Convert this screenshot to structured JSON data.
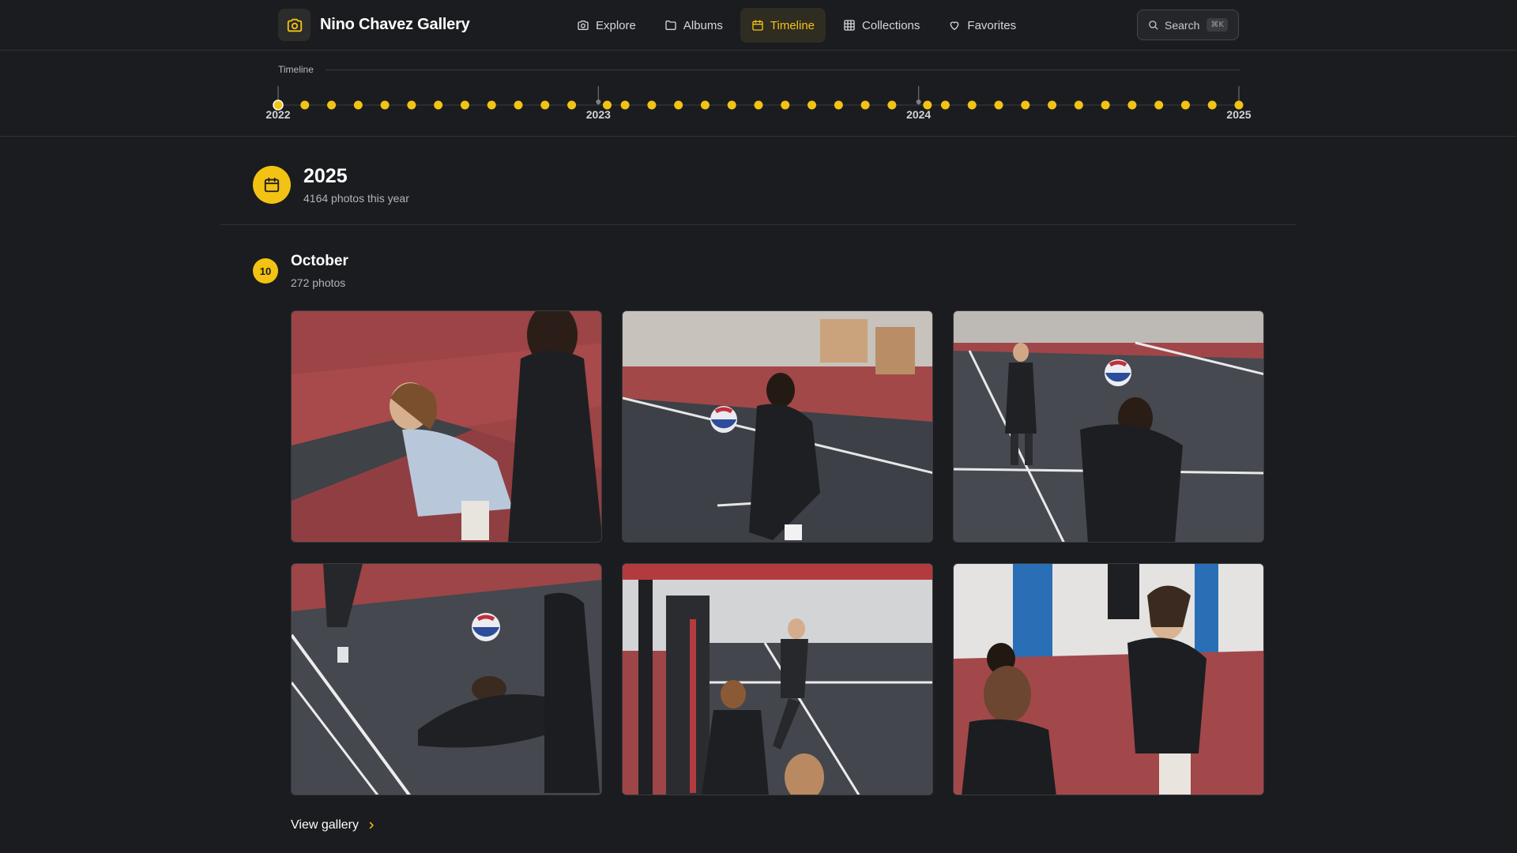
{
  "header": {
    "brand_title": "Nino Chavez Gallery",
    "brand_icon": "camera-icon",
    "nav": [
      {
        "label": "Explore",
        "icon": "camera-icon",
        "active": false
      },
      {
        "label": "Albums",
        "icon": "folder-icon",
        "active": false
      },
      {
        "label": "Timeline",
        "icon": "calendar-icon",
        "active": true
      },
      {
        "label": "Collections",
        "icon": "grid-icon",
        "active": false
      },
      {
        "label": "Favorites",
        "icon": "heart-icon",
        "active": false
      }
    ],
    "search_label": "Search",
    "search_shortcut": "⌘K"
  },
  "timeline": {
    "title": "Timeline",
    "years": [
      "2022",
      "2023",
      "2024",
      "2025"
    ],
    "markers_per_year": 12,
    "selected": "2022",
    "accent": "#f3c314"
  },
  "year_section": {
    "year": "2025",
    "subtitle": "4164 photos this year"
  },
  "month_section": {
    "badge": "10",
    "title": "October",
    "subtitle": "272 photos",
    "photos": [
      {
        "alt": "Volleyball player crouching on red court"
      },
      {
        "alt": "Player bumping a volleyball"
      },
      {
        "alt": "Player setting a volleyball overhead"
      },
      {
        "alt": "Player diving for a dig"
      },
      {
        "alt": "Player jumping to serve at the net"
      },
      {
        "alt": "Teammates laughing courtside"
      }
    ],
    "view_gallery_label": "View gallery"
  },
  "colors": {
    "background": "#1b1c1f",
    "accent": "#f3c314",
    "court_red": "#a8464a",
    "court_gray": "#4a4d52"
  }
}
